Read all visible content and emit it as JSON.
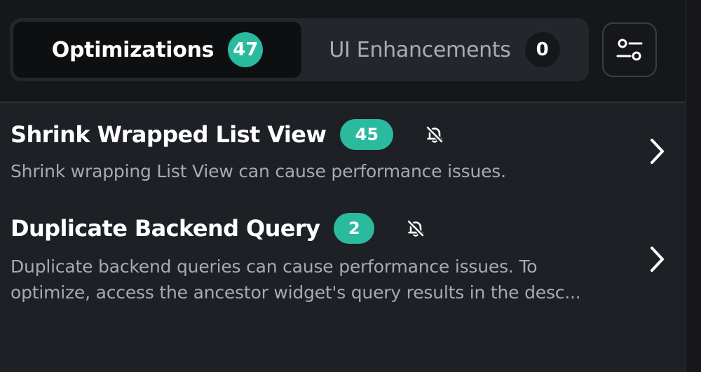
{
  "tabs": [
    {
      "label": "Optimizations",
      "count": "47",
      "active": true
    },
    {
      "label": "UI Enhancements",
      "count": "0",
      "active": false
    }
  ],
  "filter_button": {
    "icon": "sliders-icon"
  },
  "items": [
    {
      "title": "Shrink Wrapped List View",
      "count": "45",
      "description_lines": [
        "Shrink wrapping List View can cause performance issues."
      ],
      "bell_icon": "bell-off-icon",
      "chevron_icon": "chevron-right-icon"
    },
    {
      "title": "Duplicate Backend Query",
      "count": "2",
      "description_lines": [
        "Duplicate backend queries can cause performance issues. To",
        "optimize, access the ancestor widget's query results in the desc..."
      ],
      "bell_icon": "bell-off-icon",
      "chevron_icon": "chevron-right-icon"
    }
  ],
  "colors": {
    "accent": "#2aba9e",
    "background": "#1d2024",
    "header_background": "#15171a",
    "muted_text": "#a4abb2"
  }
}
